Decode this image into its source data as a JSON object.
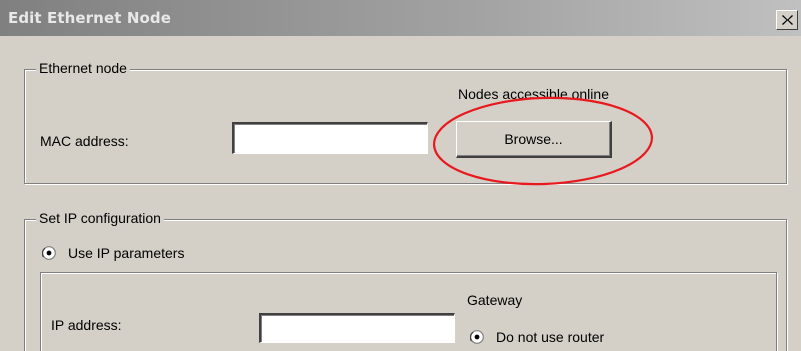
{
  "window": {
    "title": "Edit Ethernet Node",
    "close_glyph": "✕"
  },
  "ethernet_node": {
    "legend": "Ethernet node",
    "nodes_label": "Nodes accessible online",
    "mac_label": "MAC address:",
    "mac_value": "",
    "browse_label": "Browse..."
  },
  "ip_config": {
    "legend": "Set IP configuration",
    "use_ip_label": "Use IP parameters",
    "use_ip_selected": true,
    "ip_label": "IP address:",
    "ip_value": "",
    "gateway_label": "Gateway",
    "no_router_label": "Do not use router",
    "no_router_selected": true
  },
  "annotation": {
    "ellipse_color": "#e8191e"
  }
}
